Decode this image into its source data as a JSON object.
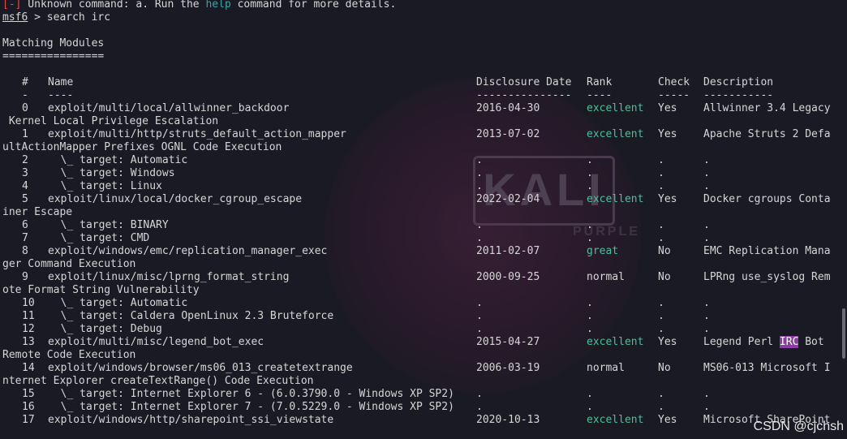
{
  "error_line": {
    "bracket": "[-]",
    "pre": " Unknown command: a. Run the ",
    "link": "help",
    "post": " command for more details."
  },
  "prompt": {
    "name": "msf6",
    "rest": " > search irc"
  },
  "section_title": "Matching Modules",
  "section_rule": "================",
  "headers": {
    "num": "#",
    "name": "Name",
    "date": "Disclosure Date",
    "rank": "Rank",
    "check": "Check",
    "desc": "Description"
  },
  "header_rules": {
    "num": "-",
    "name": "----",
    "date": "---------------",
    "rank": "----",
    "check": "-----",
    "desc": "-----------"
  },
  "rows": [
    {
      "num": "0",
      "name": "exploit/multi/local/allwinner_backdoor",
      "date": "2016-04-30",
      "rank": "excellent",
      "rank_color": "#4fbf9a",
      "check": "Yes",
      "desc": "Allwinner 3.4 Legacy",
      "wrap": " Kernel Local Privilege Escalation"
    },
    {
      "num": "1",
      "name": "exploit/multi/http/struts_default_action_mapper",
      "date": "2013-07-02",
      "rank": "excellent",
      "rank_color": "#4fbf9a",
      "check": "Yes",
      "desc": "Apache Struts 2 Defa",
      "wrap": "ultActionMapper Prefixes OGNL Code Execution"
    },
    {
      "num": "2",
      "name": "  \\_ target: Automatic",
      "date": ".",
      "rank": ".",
      "check": ".",
      "desc": "."
    },
    {
      "num": "3",
      "name": "  \\_ target: Windows",
      "date": ".",
      "rank": ".",
      "check": ".",
      "desc": "."
    },
    {
      "num": "4",
      "name": "  \\_ target: Linux",
      "date": ".",
      "rank": ".",
      "check": ".",
      "desc": "."
    },
    {
      "num": "5",
      "name": "exploit/linux/local/docker_cgroup_escape",
      "date": "2022-02-04",
      "rank": "excellent",
      "rank_color": "#4fbf9a",
      "check": "Yes",
      "desc": "Docker cgroups Conta",
      "wrap": "iner Escape"
    },
    {
      "num": "6",
      "name": "  \\_ target: BINARY",
      "date": ".",
      "rank": ".",
      "check": ".",
      "desc": "."
    },
    {
      "num": "7",
      "name": "  \\_ target: CMD",
      "date": ".",
      "rank": ".",
      "check": ".",
      "desc": "."
    },
    {
      "num": "8",
      "name": "exploit/windows/emc/replication_manager_exec",
      "date": "2011-02-07",
      "rank": "great",
      "rank_color": "#4fbf9a",
      "check": "No",
      "desc": "EMC Replication Mana",
      "wrap": "ger Command Execution"
    },
    {
      "num": "9",
      "name": "exploit/linux/misc/lprng_format_string",
      "date": "2000-09-25",
      "rank": "normal",
      "rank_color": "#d6d6d6",
      "check": "No",
      "desc": "LPRng use_syslog Rem",
      "wrap": "ote Format String Vulnerability"
    },
    {
      "num": "10",
      "name": "  \\_ target: Automatic",
      "date": ".",
      "rank": ".",
      "check": ".",
      "desc": "."
    },
    {
      "num": "11",
      "name": "  \\_ target: Caldera OpenLinux 2.3 Bruteforce",
      "date": ".",
      "rank": ".",
      "check": ".",
      "desc": "."
    },
    {
      "num": "12",
      "name": "  \\_ target: Debug",
      "date": ".",
      "rank": ".",
      "check": ".",
      "desc": "."
    },
    {
      "num": "13",
      "name": "exploit/multi/misc/legend_bot_exec",
      "date": "2015-04-27",
      "rank": "excellent",
      "rank_color": "#4fbf9a",
      "check": "Yes",
      "desc": "Legend Perl ",
      "desc_hl": "IRC",
      "desc_post": " Bot",
      "wrap": "Remote Code Execution"
    },
    {
      "num": "14",
      "name": "exploit/windows/browser/ms06_013_createtextrange",
      "date": "2006-03-19",
      "rank": "normal",
      "rank_color": "#d6d6d6",
      "check": "No",
      "desc": "MS06-013 Microsoft I",
      "wrap": "nternet Explorer createTextRange() Code Execution"
    },
    {
      "num": "15",
      "name": "  \\_ target: Internet Explorer 6 - (6.0.3790.0 - Windows XP SP2)",
      "date": ".",
      "rank": ".",
      "check": ".",
      "desc": "."
    },
    {
      "num": "16",
      "name": "  \\_ target: Internet Explorer 7 - (7.0.5229.0 - Windows XP SP2)",
      "date": ".",
      "rank": ".",
      "check": ".",
      "desc": "."
    },
    {
      "num": "17",
      "name": "exploit/windows/http/sharepoint_ssi_viewstate",
      "date": "2020-10-13",
      "rank": "excellent",
      "rank_color": "#4fbf9a",
      "check": "Yes",
      "desc": "Microsoft SharePoint"
    }
  ],
  "watermark": {
    "logo": "KALI",
    "sub": "PURPLE"
  },
  "credit": "CSDN @cjchsh"
}
